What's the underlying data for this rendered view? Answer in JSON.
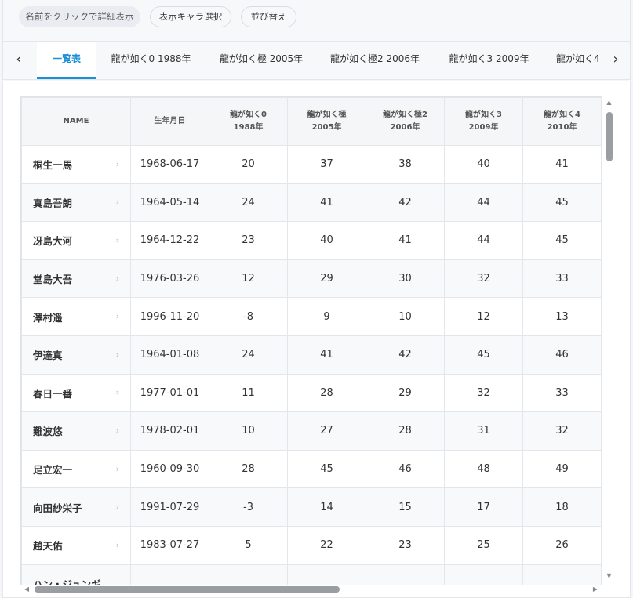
{
  "toolbar": {
    "info_label": "名前をクリックで詳細表示",
    "select_label": "表示キャラ選択",
    "sort_label": "並び替え"
  },
  "tabs": {
    "prev_icon": "‹",
    "next_icon": "›",
    "items": [
      {
        "label": "一覧表",
        "active": true
      },
      {
        "label": "龍が如く0 1988年"
      },
      {
        "label": "龍が如く極 2005年"
      },
      {
        "label": "龍が如く極2 2006年"
      },
      {
        "label": "龍が如く3 2009年"
      },
      {
        "label": "龍が如く4"
      }
    ]
  },
  "table": {
    "headers": {
      "name": "NAME",
      "birth": "生年月日",
      "g0": [
        "龍が如く0",
        "1988年"
      ],
      "gk": [
        "龍が如く極",
        "2005年"
      ],
      "gk2": [
        "龍が如く極2",
        "2006年"
      ],
      "g3": [
        "龍が如く3",
        "2009年"
      ],
      "g4": [
        "龍が如く4",
        "2010年"
      ]
    },
    "row_icon": "›",
    "rows": [
      {
        "name": "桐生一馬",
        "birth": "1968-06-17",
        "ages": [
          "20",
          "37",
          "38",
          "40",
          "41"
        ]
      },
      {
        "name": "真島吾朗",
        "birth": "1964-05-14",
        "ages": [
          "24",
          "41",
          "42",
          "44",
          "45"
        ]
      },
      {
        "name": "冴島大河",
        "birth": "1964-12-22",
        "ages": [
          "23",
          "40",
          "41",
          "44",
          "45"
        ]
      },
      {
        "name": "堂島大吾",
        "birth": "1976-03-26",
        "ages": [
          "12",
          "29",
          "30",
          "32",
          "33"
        ]
      },
      {
        "name": "澤村遥",
        "birth": "1996-11-20",
        "ages": [
          "-8",
          "9",
          "10",
          "12",
          "13"
        ]
      },
      {
        "name": "伊達真",
        "birth": "1964-01-08",
        "ages": [
          "24",
          "41",
          "42",
          "45",
          "46"
        ]
      },
      {
        "name": "春日一番",
        "birth": "1977-01-01",
        "ages": [
          "11",
          "28",
          "29",
          "32",
          "33"
        ]
      },
      {
        "name": "難波悠",
        "birth": "1978-02-01",
        "ages": [
          "10",
          "27",
          "28",
          "31",
          "32"
        ]
      },
      {
        "name": "足立宏一",
        "birth": "1960-09-30",
        "ages": [
          "28",
          "45",
          "46",
          "48",
          "49"
        ]
      },
      {
        "name": "向田紗栄子",
        "birth": "1991-07-29",
        "ages": [
          "-3",
          "14",
          "15",
          "17",
          "18"
        ]
      },
      {
        "name": "趙天佑",
        "birth": "1983-07-27",
        "ages": [
          "5",
          "22",
          "23",
          "25",
          "26"
        ]
      },
      {
        "name": "ハン・ジュンギ",
        "birth": "",
        "ages": [
          "",
          "",
          "",
          "",
          ""
        ]
      }
    ]
  },
  "scrollbars": {
    "up": "▲",
    "down": "▼",
    "left": "◀",
    "right": "▶"
  }
}
